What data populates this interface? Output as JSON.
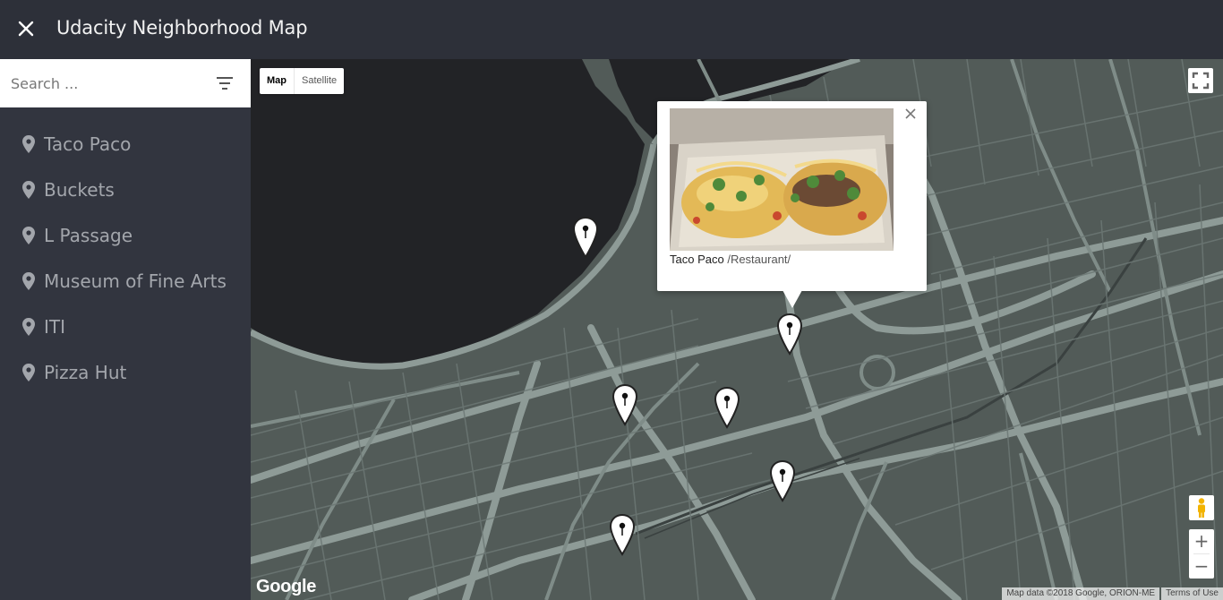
{
  "app": {
    "title": "Udacity Neighborhood Map"
  },
  "icons": {
    "close": "close-icon",
    "filter": "filter-icon",
    "pin": "location-pin-icon",
    "fullscreen": "fullscreen-icon",
    "pegman": "pegman-icon"
  },
  "colors": {
    "topbar": "#2d3039",
    "sidebar": "#32353f",
    "map_land": "#525b58",
    "map_water": "#222326",
    "map_road": "#8e9b97",
    "list_text": "#a3a6ac"
  },
  "search": {
    "placeholder": "Search ...",
    "value": ""
  },
  "places": [
    {
      "label": "Taco Paco"
    },
    {
      "label": "Buckets"
    },
    {
      "label": "L Passage"
    },
    {
      "label": "Museum of Fine Arts"
    },
    {
      "label": "ITI"
    },
    {
      "label": "Pizza Hut"
    }
  ],
  "map": {
    "type_controls": {
      "map": "Map",
      "satellite": "Satellite"
    },
    "zoom": {
      "in": "+",
      "out": "−"
    },
    "logo": "Google",
    "attribution": "Map data ©2018 Google, ORION-ME",
    "terms": "Terms of Use"
  },
  "infowindow": {
    "name": "Taco Paco",
    "type": "/Restaurant/"
  }
}
